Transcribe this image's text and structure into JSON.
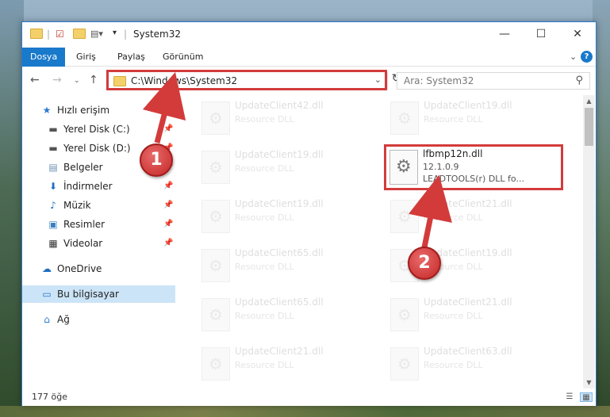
{
  "window": {
    "title": "System32",
    "minimize": "—",
    "maximize": "☐",
    "close": "✕"
  },
  "ribbon": {
    "tabs": [
      "Dosya",
      "Giriş",
      "Paylaş",
      "Görünüm"
    ],
    "help": "?"
  },
  "nav": {
    "address": "C:\\Windows\\System32",
    "search_placeholder": "Ara: System32"
  },
  "sidebar": {
    "items": [
      {
        "label": "Hızlı erişim",
        "icon": "star-icon",
        "pinned": false
      },
      {
        "label": "Yerel Disk (C:)",
        "icon": "drive-icon",
        "pinned": true
      },
      {
        "label": "Yerel Disk (D:)",
        "icon": "drive-icon",
        "pinned": true
      },
      {
        "label": "Belgeler",
        "icon": "documents-icon",
        "pinned": true
      },
      {
        "label": "İndirmeler",
        "icon": "download-icon",
        "pinned": true
      },
      {
        "label": "Müzik",
        "icon": "music-icon",
        "pinned": true
      },
      {
        "label": "Resimler",
        "icon": "pictures-icon",
        "pinned": true
      },
      {
        "label": "Videolar",
        "icon": "videos-icon",
        "pinned": true
      },
      {
        "label": "OneDrive",
        "icon": "cloud-icon",
        "pinned": false
      },
      {
        "label": "Bu bilgisayar",
        "icon": "computer-icon",
        "pinned": false
      },
      {
        "label": "Ağ",
        "icon": "network-icon",
        "pinned": false
      }
    ]
  },
  "files_left": [
    {
      "name": "UpdateClient42.dll",
      "type": "Resource DLL"
    },
    {
      "name": "UpdateClient19.dll",
      "type": "Resource DLL"
    },
    {
      "name": "UpdateClient19.dll",
      "type": "Resource DLL"
    },
    {
      "name": "UpdateClient65.dll",
      "type": "Resource DLL"
    },
    {
      "name": "UpdateClient65.dll",
      "type": "Resource DLL"
    },
    {
      "name": "UpdateClient21.dll",
      "type": "Resource DLL"
    }
  ],
  "files_right": [
    {
      "name": "UpdateClient19.dll",
      "type": "Resource DLL"
    },
    {
      "name": "UpdateClient21.dll",
      "type": "Resource DLL"
    },
    {
      "name": "UpdateClient19.dll",
      "type": "Resource DLL"
    },
    {
      "name": "UpdateClient21.dll",
      "type": "Resource DLL"
    },
    {
      "name": "UpdateClient63.dll",
      "type": "Resource DLL"
    }
  ],
  "highlighted_file": {
    "name": "lfbmp12n.dll",
    "version": "12.1.0.9",
    "description": "LEADTOOLS(r) DLL fo..."
  },
  "status": {
    "count": "177 öğe"
  },
  "annotations": {
    "badge1": "1",
    "badge2": "2",
    "color": "#d33b3b"
  }
}
